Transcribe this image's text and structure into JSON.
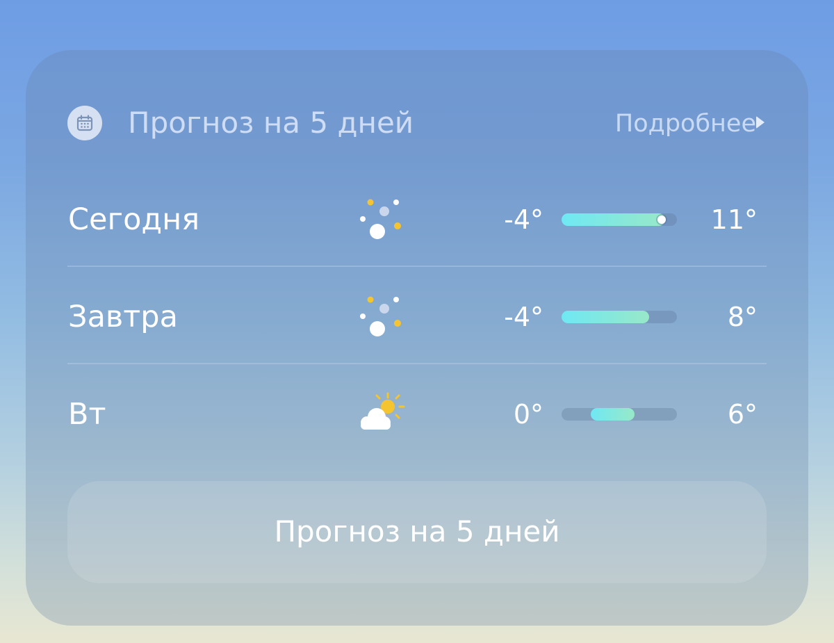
{
  "header": {
    "title": "Прогноз на 5 дней",
    "more_label": "Подробнее",
    "icon": "calendar-icon"
  },
  "forecast": [
    {
      "day": "Сегодня",
      "icon": "snow-icon",
      "min": "-4°",
      "max": "11°",
      "range_start": 0.0,
      "range_end": 0.9,
      "current_marker": 0.87
    },
    {
      "day": "Завтра",
      "icon": "snow-icon",
      "min": "-4°",
      "max": "8°",
      "range_start": 0.0,
      "range_end": 0.76
    },
    {
      "day": "Вт",
      "icon": "partly-cloudy-icon",
      "min": "0°",
      "max": "6°",
      "range_start": 0.25,
      "range_end": 0.63
    }
  ],
  "button": {
    "label": "Прогноз на 5 дней"
  },
  "colors": {
    "bar_gradient_start": "#6fe8f4",
    "bar_gradient_end": "#98e8c8",
    "sun": "#f5c431",
    "text": "#ffffff"
  }
}
